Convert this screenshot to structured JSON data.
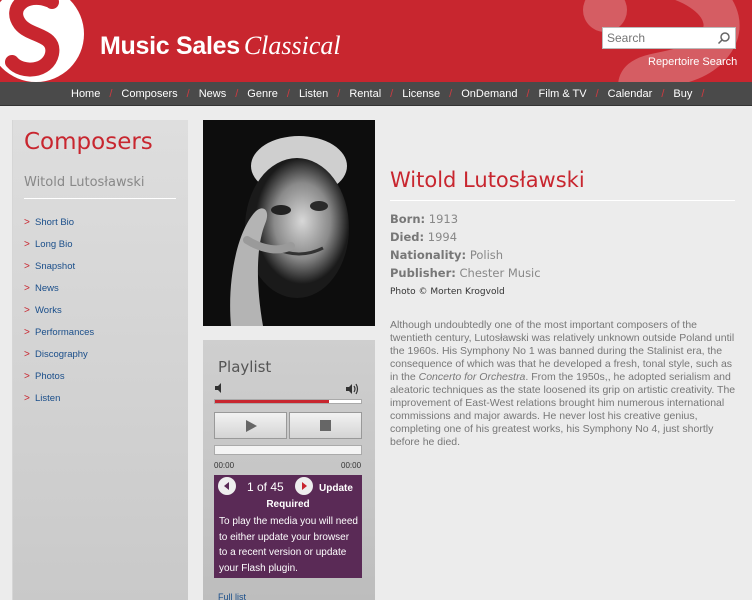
{
  "header": {
    "brand_main": "Music Sales",
    "brand_sub": "Classical",
    "search_placeholder": "Search",
    "repertoire_search": "Repertoire Search"
  },
  "nav": {
    "items": [
      "Home",
      "Composers",
      "News",
      "Genre",
      "Listen",
      "Rental",
      "License",
      "OnDemand",
      "Film & TV",
      "Calendar",
      "Buy"
    ],
    "separator": "/"
  },
  "sidebar": {
    "title": "Composers",
    "composer_name": "Witold Lutosławski",
    "links": [
      "Short Bio",
      "Long Bio",
      "Snapshot",
      "News",
      "Works",
      "Performances",
      "Discography",
      "Photos",
      "Listen"
    ],
    "bullet": ">"
  },
  "playlist": {
    "title": "Playlist",
    "volume_fraction": 0.78,
    "time_start": "00:00",
    "time_end": "00:00",
    "counter": "1 of 45",
    "update_label": "Update",
    "required_label": "Required",
    "message": "To play the media you will need to either update your browser to a recent version or update your Flash plugin.",
    "full_list": "Full list"
  },
  "composer": {
    "name": "Witold Lutosławski",
    "born_label": "Born:",
    "born": "1913",
    "died_label": "Died:",
    "died": "1994",
    "nationality_label": "Nationality:",
    "nationality": "Polish",
    "publisher_label": "Publisher:",
    "publisher": "Chester Music",
    "photo_credit": "Photo © Morten Krogvold",
    "bio_part1": "Although undoubtedly one of the most important composers of the twentieth century, Lutosławski was relatively unknown outside Poland until the 1960s. His Symphony No 1 was banned during the Stalinist era, the consequence of which was that he developed a fresh, tonal style, such as in the ",
    "bio_italic": "Concerto for Orchestra",
    "bio_part2": ". From the 1950s,, he adopted serialism and aleatoric techniques as the state loosened its grip on artistic creativity. The improvement of East-West relations brought him numerous international commissions and major awards. He never lost his creative genius, completing one of his greatest works, his Symphony No 4, just shortly before he died."
  },
  "colors": {
    "brand_red": "#c8262f",
    "nav_bg": "#4a4a4a",
    "link_blue": "#1a4e8a",
    "update_box": "#5a2a56"
  }
}
